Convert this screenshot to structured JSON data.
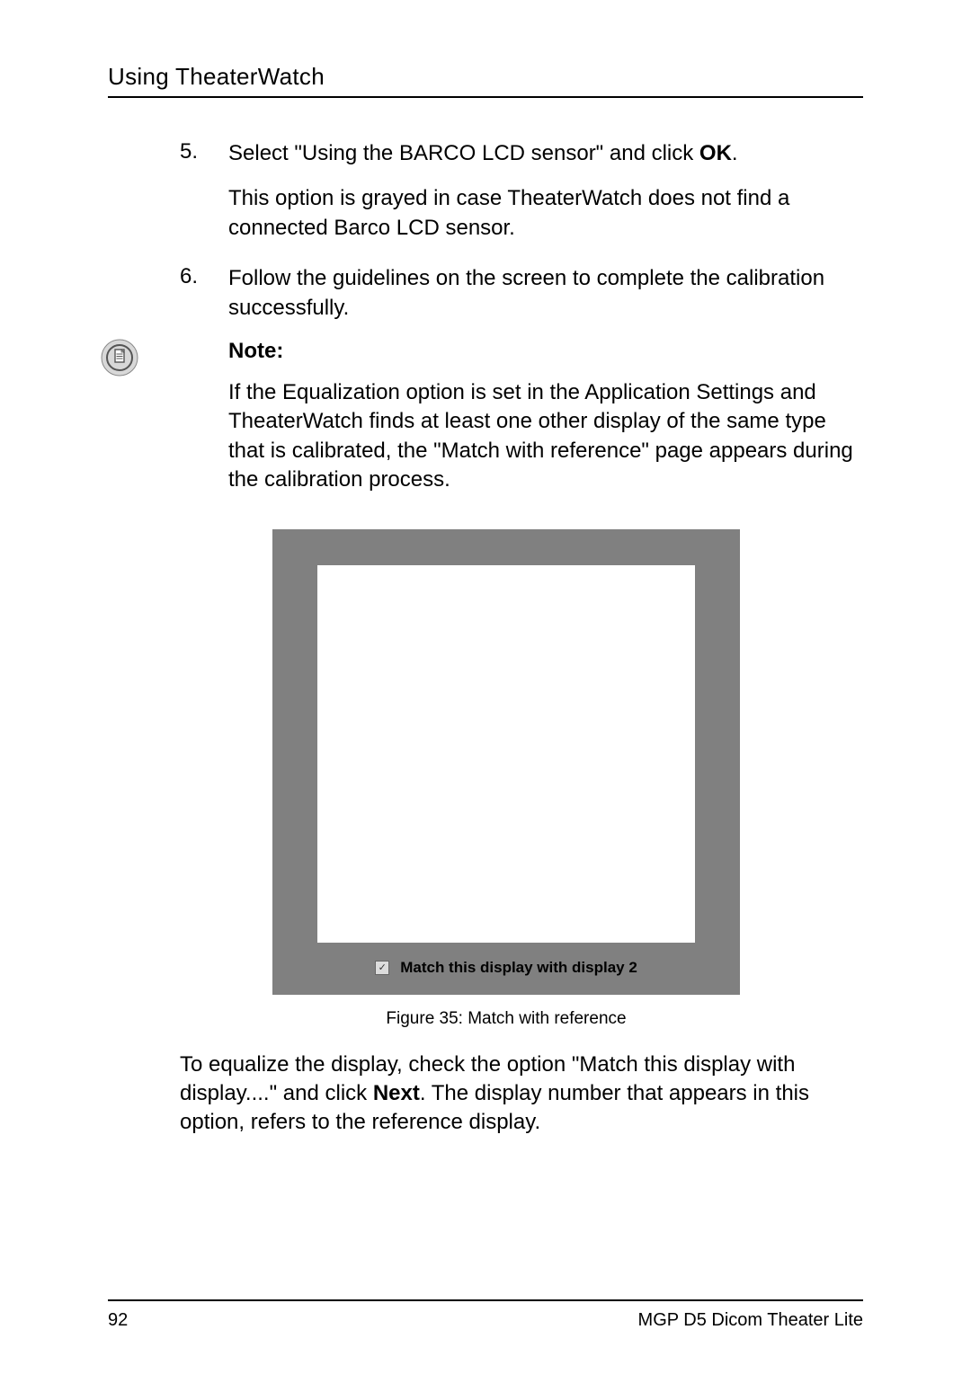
{
  "header": {
    "title": "Using TheaterWatch"
  },
  "steps": [
    {
      "num": "5.",
      "text_pre": "Select \"Using the BARCO LCD sensor\" and click ",
      "text_bold": "OK",
      "text_post": ".",
      "sub": "This option is grayed in case TheaterWatch does not find a connected Barco LCD sensor."
    },
    {
      "num": "6.",
      "text_pre": "Follow the guidelines on the screen to complete the calibration successfully.",
      "text_bold": "",
      "text_post": "",
      "sub": ""
    }
  ],
  "note": {
    "label": "Note:",
    "text": "If the Equalization option is set in the Application Settings and TheaterWatch finds at least one other display of the same type that is calibrated, the \"Match with reference\" page appears during the calibration process."
  },
  "figure": {
    "checkbox_state": "checked",
    "bar_text": "Match this display with display 2",
    "caption": "Figure 35: Match with reference"
  },
  "after": {
    "pre": "To equalize the display, check the option \"Match this display with display....\" and click ",
    "bold": "Next",
    "post": ". The display number that appears in this option, refers to the reference display."
  },
  "footer": {
    "page_num": "92",
    "doc_title": "MGP D5 Dicom Theater Lite"
  },
  "icons": {
    "note_icon": "note-document-icon"
  }
}
